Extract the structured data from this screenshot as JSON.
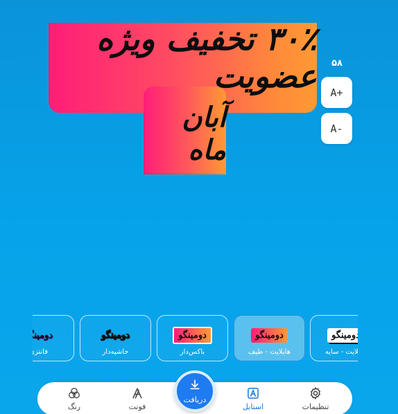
{
  "banner": {
    "line1": "۳۰٪ تخفیف ویژه عضویت",
    "line2": "آبان ماه"
  },
  "font_size": {
    "value": "۵۸",
    "increase_label": "A+",
    "decrease_label": "A-"
  },
  "styles": {
    "selected": "هایلایت - طیف",
    "items": [
      {
        "preview": "دومینگو",
        "label": "هایلایت - سایه"
      },
      {
        "preview": "دومینگو",
        "label": "هایلایت - طیف"
      },
      {
        "preview": "دومینگو",
        "label": "باکس‌دار"
      },
      {
        "preview": "دومینگو",
        "label": "حاشیه‌دار"
      },
      {
        "preview": "دومینگو",
        "label": "فانتزی"
      }
    ]
  },
  "nav": {
    "settings": "تنظیمات",
    "style": "استایل",
    "download": "دریافت",
    "font": "فونت",
    "color": "رنگ"
  },
  "colors": {
    "background": "#0a9ee2",
    "accent": "#1e7bf0",
    "gradient_start": "#ff1d78",
    "gradient_end": "#ff9a33"
  }
}
